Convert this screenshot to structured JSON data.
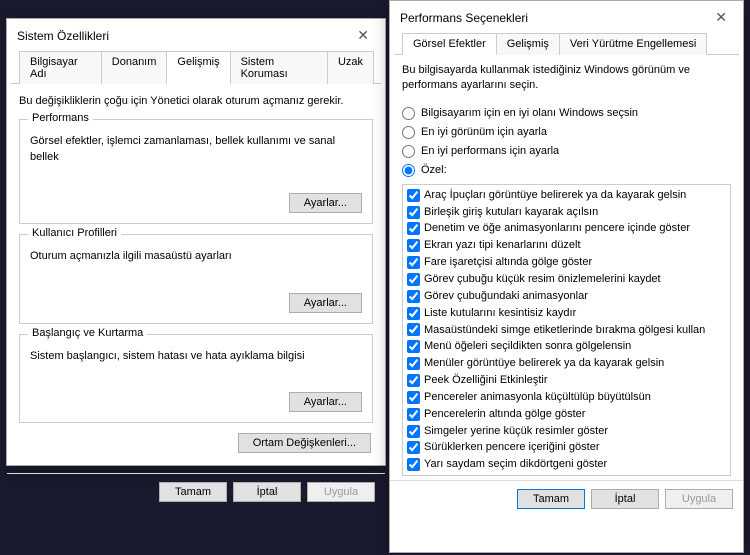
{
  "win1": {
    "title": "Sistem Özellikleri",
    "tabs": [
      "Bilgisayar Adı",
      "Donanım",
      "Gelişmiş",
      "Sistem Koruması",
      "Uzak"
    ],
    "active_tab": 2,
    "desc": "Bu değişikliklerin çoğu için Yönetici olarak oturum açmanız gerekir.",
    "groups": [
      {
        "title": "Performans",
        "desc": "Görsel efektler, işlemci zamanlaması, bellek kullanımı ve sanal bellek",
        "button": "Ayarlar..."
      },
      {
        "title": "Kullanıcı Profilleri",
        "desc": "Oturum açmanızla ilgili masaüstü ayarları",
        "button": "Ayarlar..."
      },
      {
        "title": "Başlangıç ve Kurtarma",
        "desc": "Sistem başlangıcı, sistem hatası ve hata ayıklama bilgisi",
        "button": "Ayarlar..."
      }
    ],
    "env_button": "Ortam Değişkenleri...",
    "footer": {
      "ok": "Tamam",
      "cancel": "İptal",
      "apply": "Uygula"
    }
  },
  "win2": {
    "title": "Performans Seçenekleri",
    "tabs": [
      "Görsel Efektler",
      "Gelişmiş",
      "Veri Yürütme Engellemesi"
    ],
    "active_tab": 0,
    "desc": "Bu bilgisayarda kullanmak istediğiniz Windows görünüm ve performans ayarlarını seçin.",
    "radios": [
      "Bilgisayarım için en iyi olanı Windows seçsin",
      "En iyi görünüm için ayarla",
      "En iyi performans için ayarla",
      "Özel:"
    ],
    "radio_selected": 3,
    "checks": [
      "Araç İpuçları görüntüye belirerek ya da kayarak gelsin",
      "Birleşik giriş kutuları kayarak açılsın",
      "Denetim ve öğe animasyonlarını pencere içinde göster",
      "Ekran yazı tipi kenarlarını düzelt",
      "Fare işaretçisi altında gölge göster",
      "Görev çubuğu küçük resim önizlemelerini kaydet",
      "Görev çubuğundaki animasyonlar",
      "Liste kutularını kesintisiz kaydır",
      "Masaüstündeki simge etiketlerinde bırakma gölgesi kullan",
      "Menü öğeleri seçildikten sonra gölgelensin",
      "Menüler görüntüye belirerek ya da kayarak gelsin",
      "Peek Özelliğini Etkinleştir",
      "Pencereler animasyonla küçültülüp büyütülsün",
      "Pencerelerin altında gölge göster",
      "Simgeler yerine küçük resimler göster",
      "Sürüklerken pencere içeriğini göster",
      "Yarı saydam seçim dikdörtgeni göster"
    ],
    "footer": {
      "ok": "Tamam",
      "cancel": "İptal",
      "apply": "Uygula"
    }
  }
}
